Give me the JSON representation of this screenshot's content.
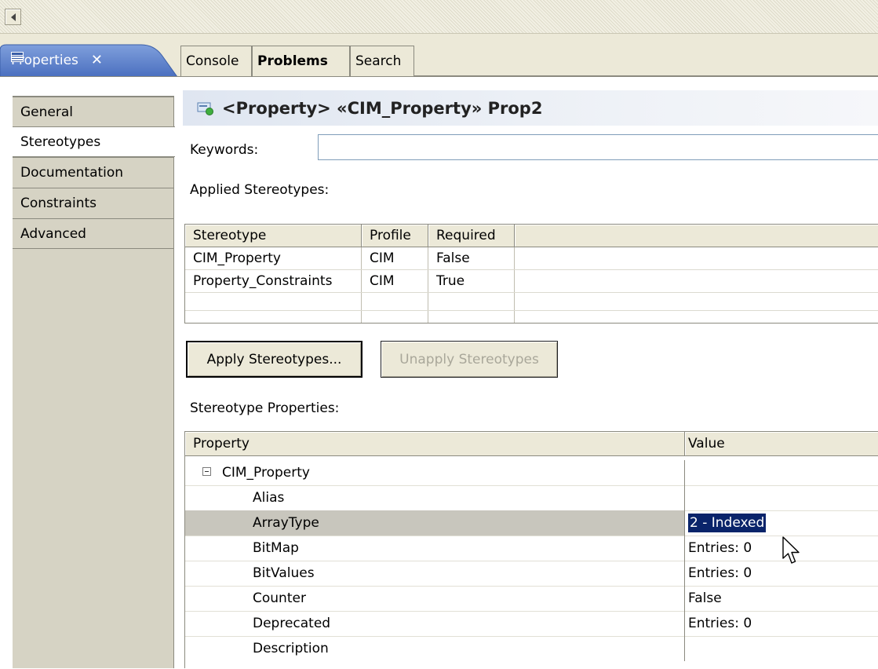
{
  "tabs": {
    "active": {
      "label": "Properties",
      "close": "✕"
    },
    "others": [
      {
        "label": "Console"
      },
      {
        "label": "Problems"
      },
      {
        "label": "Search"
      }
    ]
  },
  "sidebar": {
    "items": [
      {
        "label": "General"
      },
      {
        "label": "Stereotypes",
        "selected": true
      },
      {
        "label": "Documentation"
      },
      {
        "label": "Constraints"
      },
      {
        "label": "Advanced"
      }
    ]
  },
  "header": {
    "title": "<Property> «CIM_Property» Prop2"
  },
  "keywords": {
    "label": "Keywords:",
    "value": ""
  },
  "applied": {
    "label": "Applied Stereotypes:",
    "columns": [
      "Stereotype",
      "Profile",
      "Required"
    ],
    "rows": [
      [
        "CIM_Property",
        "CIM",
        "False"
      ],
      [
        "Property_Constraints",
        "CIM",
        "True"
      ]
    ]
  },
  "buttons": {
    "apply": "Apply Stereotypes...",
    "unapply": "Unapply Stereotypes"
  },
  "stereotype_properties": {
    "label": "Stereotype Properties:",
    "columns": [
      "Property",
      "Value"
    ],
    "group": "CIM_Property",
    "rows": [
      {
        "name": "Alias",
        "value": ""
      },
      {
        "name": "ArrayType",
        "value": "2 - Indexed",
        "selected": true
      },
      {
        "name": "BitMap",
        "value": "Entries: 0"
      },
      {
        "name": "BitValues",
        "value": "Entries: 0"
      },
      {
        "name": "Counter",
        "value": "False"
      },
      {
        "name": "Deprecated",
        "value": "Entries: 0"
      },
      {
        "name": "Description",
        "value": ""
      }
    ]
  },
  "colors": {
    "selection": "#0a246a",
    "header_gradient": "#dfe6f1",
    "tab_active": "#5b7fc6"
  }
}
